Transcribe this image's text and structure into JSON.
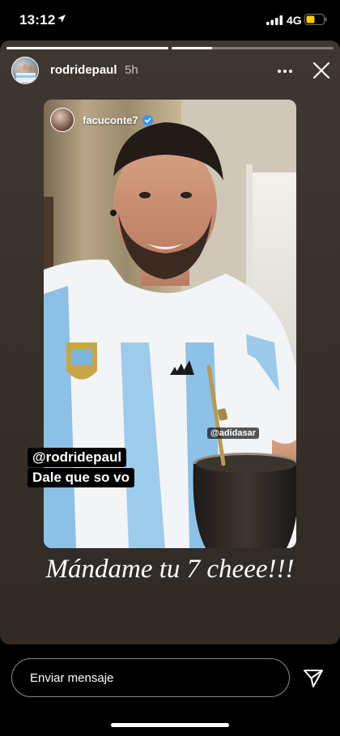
{
  "status_bar": {
    "time": "13:12",
    "network": "4G",
    "battery_level": 0.5,
    "battery_color": "#ffcc00"
  },
  "story": {
    "progress": [
      1.0,
      0.25
    ],
    "username": "rodridepaul",
    "time_ago": "5h",
    "shared_post": {
      "username": "facuconte7",
      "verified_badge_color": "#3897f0",
      "mention_tag": "@rodridepaul",
      "sticker_caption": "Dale que so vo",
      "brand_tag": "@adidasar"
    },
    "caption": "Mándame tu 7 cheee!!!"
  },
  "reply": {
    "placeholder": "Enviar mensaje"
  },
  "icons": {
    "location": "location-arrow-icon",
    "signal": "cellular-signal-icon",
    "battery": "battery-icon",
    "more": "more-options-icon",
    "close": "close-icon",
    "verified": "verified-badge-icon",
    "send": "send-direct-icon"
  }
}
